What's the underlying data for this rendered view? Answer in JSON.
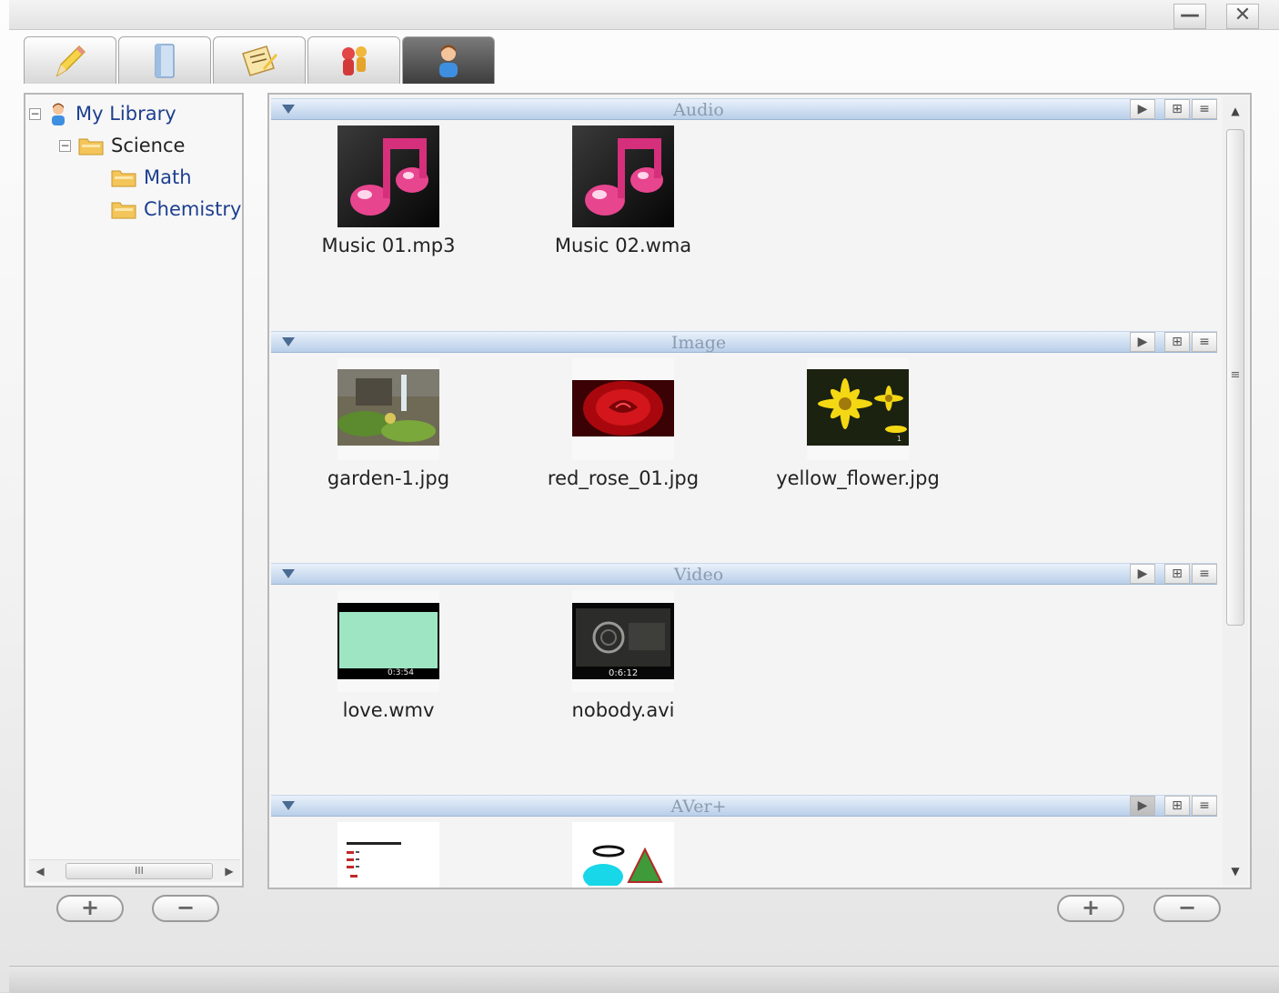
{
  "window": {
    "minimize_label": "—",
    "close_label": "✕"
  },
  "tabs": [
    {
      "icon": "pencil-icon"
    },
    {
      "icon": "book-icon"
    },
    {
      "icon": "clipboard-icon"
    },
    {
      "icon": "people-icon"
    },
    {
      "icon": "user-icon",
      "active": true
    }
  ],
  "tree": {
    "root": {
      "label": "My Library",
      "expander": "−"
    },
    "science": {
      "label": "Science",
      "expander": "−"
    },
    "math": {
      "label": "Math"
    },
    "chemistry": {
      "label": "Chemistry"
    },
    "scroll_left": "◀",
    "scroll_right": "▶",
    "scroll_grip": "III"
  },
  "left_buttons": {
    "add": "+",
    "remove": "−"
  },
  "right_buttons": {
    "add": "+",
    "remove": "−"
  },
  "groups": {
    "audio": {
      "title": "Audio",
      "items": [
        {
          "name": "Music 01.mp3",
          "icon": "music-note-icon"
        },
        {
          "name": "Music 02.wma",
          "icon": "music-note-icon"
        }
      ]
    },
    "image": {
      "title": "Image",
      "items": [
        {
          "name": "garden-1.jpg"
        },
        {
          "name": "red_rose_01.jpg"
        },
        {
          "name": "yellow_flower.jpg",
          "overlay": "1"
        }
      ]
    },
    "video": {
      "title": "Video",
      "items": [
        {
          "name": "love.wmv",
          "duration": "0:3:54"
        },
        {
          "name": "nobody.avi",
          "duration": "0:6:12"
        }
      ]
    },
    "aver": {
      "title": "AVer+",
      "items": [
        {
          "name": "",
          "icon": "document-thumbnail"
        },
        {
          "name": "",
          "icon": "shapes-thumbnail"
        }
      ]
    }
  },
  "header_buttons": {
    "play": "▶",
    "grid": "⊞",
    "list": "≡"
  },
  "vscroll": {
    "up": "▲",
    "down": "▼",
    "grip": "≡"
  },
  "colors": {
    "header_blue": "#b9cfe9",
    "active_tab": "#3d3d3d",
    "folder": "#f3c55a"
  }
}
